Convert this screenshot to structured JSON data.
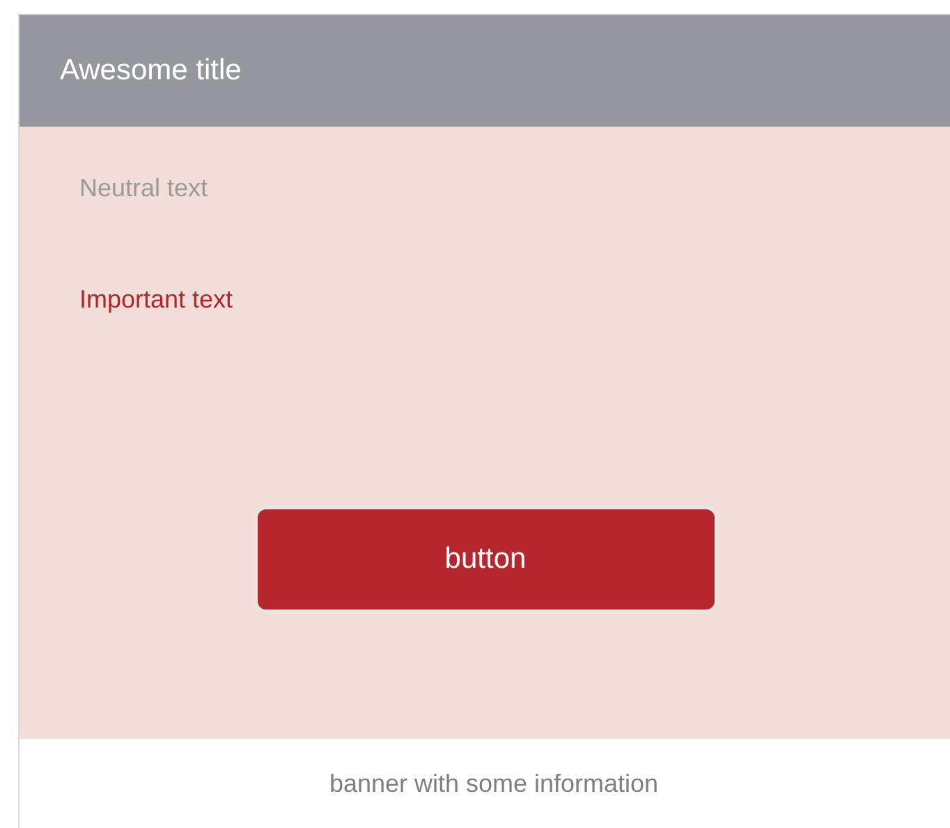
{
  "header": {
    "title": "Awesome title"
  },
  "texts": [
    {
      "text": "Neutral text",
      "kind": "neutral"
    },
    {
      "text": "Important text",
      "kind": "important"
    }
  ],
  "button": {
    "label": "button"
  },
  "banner": {
    "text": "banner with some information"
  }
}
